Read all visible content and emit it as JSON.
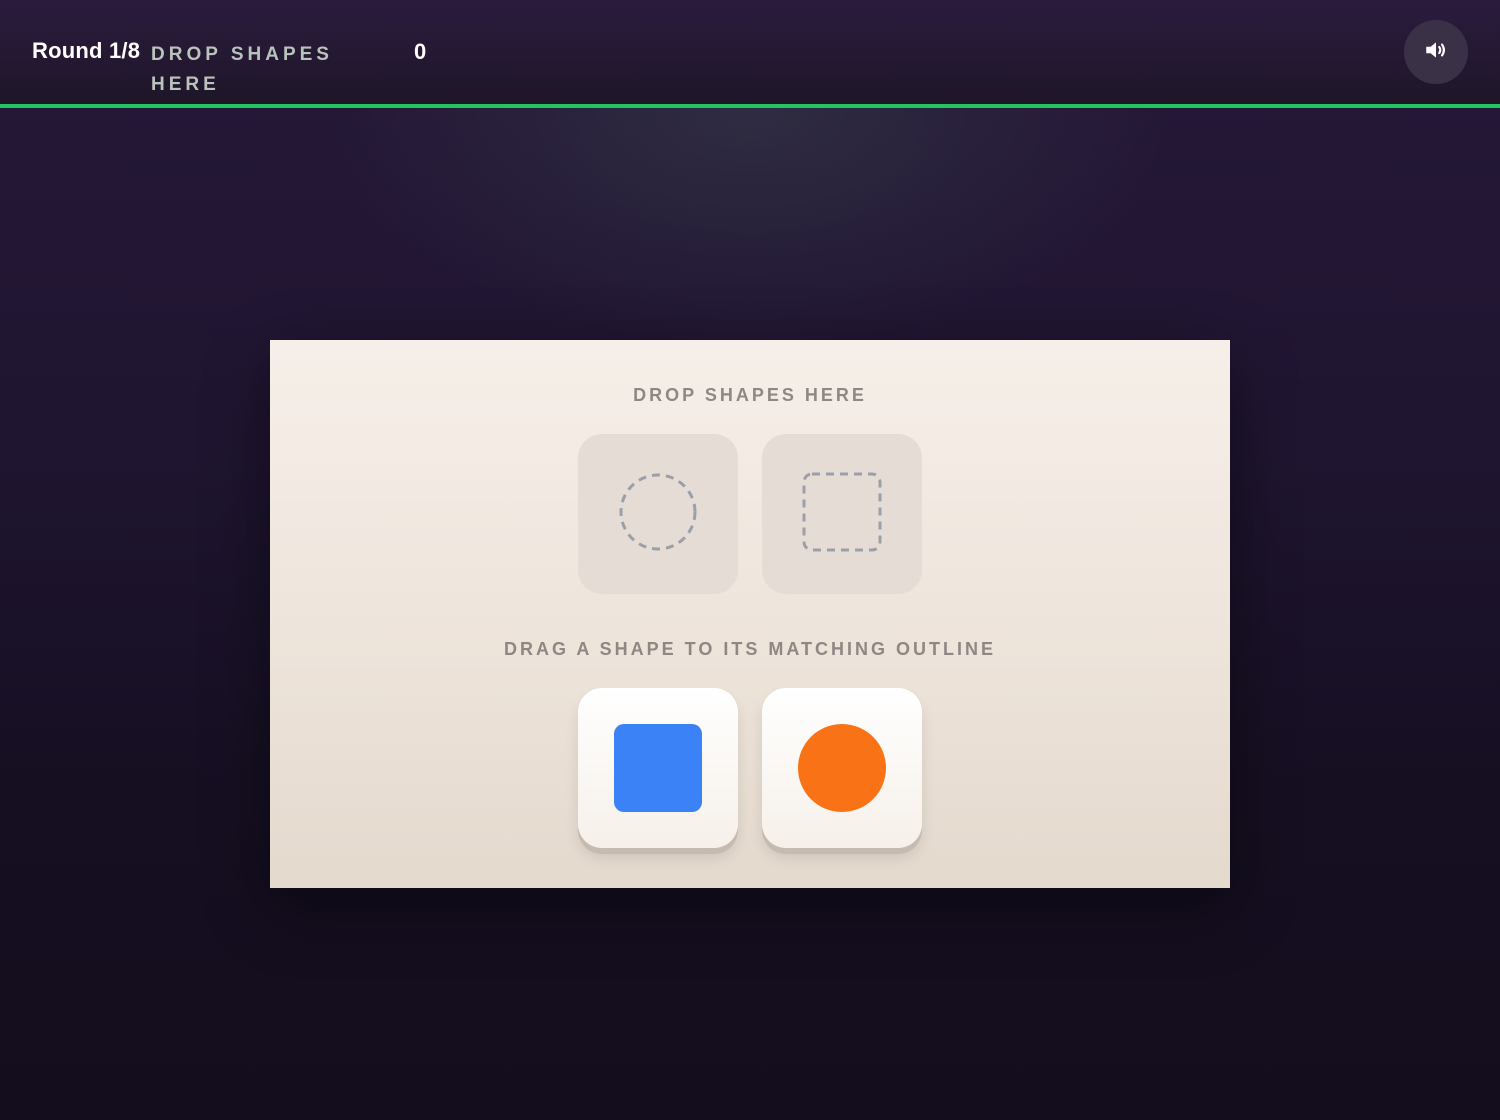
{
  "header": {
    "round_label": "Round 1/8",
    "instruction": "DROP SHAPES HERE",
    "score": "0",
    "sound_icon": "speaker-volume-icon",
    "progress_color": "#22c55e",
    "progress": 1.0
  },
  "board": {
    "drop_title": "DROP SHAPES HERE",
    "drag_title": "DRAG A SHAPE TO ITS MATCHING OUTLINE",
    "targets": [
      {
        "shape": "circle",
        "icon": "dashed-circle-outline-icon"
      },
      {
        "shape": "square",
        "icon": "dashed-square-outline-icon"
      }
    ],
    "pieces": [
      {
        "shape": "square",
        "color": "#3b82f6",
        "icon": "blue-square-shape"
      },
      {
        "shape": "circle",
        "color": "#f97316",
        "icon": "orange-circle-shape"
      }
    ]
  }
}
